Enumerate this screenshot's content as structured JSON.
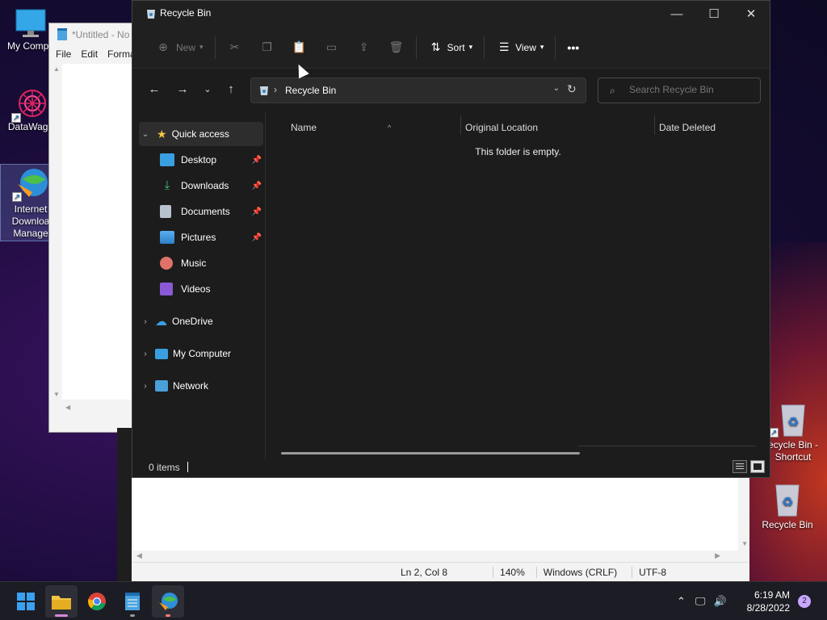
{
  "desktop": {
    "icons": [
      {
        "label": "My Compu",
        "name": "my-computer"
      },
      {
        "label": "DataWago",
        "name": "datawagon"
      },
      {
        "label": "Internet\nDownloa\nManage",
        "line1": "Internet",
        "line2": "Downloa",
        "line3": "Manage",
        "name": "internet-download-manager"
      },
      {
        "label": "Recycle Bin - Shortcut",
        "line1": "ecycle Bin -",
        "line2": "Shortcut",
        "name": "recycle-bin-shortcut"
      },
      {
        "label": "Recycle Bin",
        "name": "recycle-bin"
      }
    ]
  },
  "notepad_back": {
    "title": "*Untitled - No",
    "menu": [
      "File",
      "Edit",
      "Forma"
    ]
  },
  "notepad_front": {
    "status": {
      "position": "Ln 2, Col 8",
      "zoom": "140%",
      "line_ending": "Windows (CRLF)",
      "encoding": "UTF-8"
    }
  },
  "explorer": {
    "title": "Recycle Bin",
    "toolbar": {
      "new_label": "New",
      "sort_label": "Sort",
      "view_label": "View",
      "more_label": "•••"
    },
    "address": {
      "path": "Recycle Bin"
    },
    "search": {
      "placeholder": "Search Recycle Bin"
    },
    "sidebar": {
      "quick_access": "Quick access",
      "items": [
        {
          "label": "Desktop",
          "pinned": true
        },
        {
          "label": "Downloads",
          "pinned": true
        },
        {
          "label": "Documents",
          "pinned": true
        },
        {
          "label": "Pictures",
          "pinned": true
        },
        {
          "label": "Music",
          "pinned": false
        },
        {
          "label": "Videos",
          "pinned": false
        }
      ],
      "roots": [
        "OneDrive",
        "My Computer",
        "Network"
      ]
    },
    "columns": [
      "Name",
      "Original Location",
      "Date Deleted"
    ],
    "empty_message": "This folder is empty.",
    "status": {
      "items": "0 items"
    }
  },
  "taskbar": {
    "apps": [
      "start",
      "file-explorer",
      "chrome",
      "notepad",
      "internet-download-manager"
    ],
    "time": "6:19 AM",
    "date": "8/28/2022",
    "notification_count": "2"
  },
  "colors": {
    "accent_folder": "#f4c542",
    "windows_blue": "#1e90ff",
    "explorer_bg": "#1c1c1c"
  }
}
